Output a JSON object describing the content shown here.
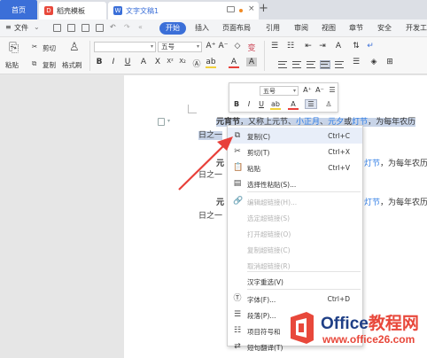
{
  "tabs": {
    "home": "首页",
    "template": "稻壳模板",
    "document": "文字文稿1",
    "add": "+"
  },
  "menubar": {
    "file": "文件",
    "file_icon": "hamburger-icon",
    "quick_arrows": "«",
    "start": "开始",
    "items": [
      "插入",
      "页面布局",
      "引用",
      "审阅",
      "视图",
      "章节",
      "安全",
      "开发工"
    ]
  },
  "ribbon": {
    "paste": "粘贴",
    "cut": "剪切",
    "copy": "复制",
    "format_painter": "格式刷",
    "font_size": "五号",
    "font_name": "",
    "bold": "B",
    "italic": "I",
    "underline": "U",
    "grow_font": "A⁺",
    "shrink_font": "A⁻",
    "clear_format": "◇",
    "phonetic": "变"
  },
  "document": {
    "line1_bold": "元宵节",
    "line1_text_a": "，又称上元节、",
    "line1_link1": "小正月",
    "line1_text_b": "、",
    "line1_link2": "元夕",
    "line1_text_c": "或",
    "line1_link3": "灯节",
    "line1_text_d": "，为每年农历",
    "line2": "日之一",
    "line3_bold": "元",
    "line3_link": "灯节",
    "line3_text": "，为每年农历",
    "line4": "日之一",
    "line5_bold": "元",
    "line5_link": "灯节",
    "line5_text": "，为每年农历",
    "line6": "日之一"
  },
  "mini_toolbar": {
    "font_size": "五号",
    "grow": "A⁺",
    "shrink": "A⁻",
    "bold": "B",
    "italic": "I",
    "underline": "U"
  },
  "context_menu": {
    "items": [
      {
        "label": "复制(C)",
        "shortcut": "Ctrl+C",
        "icon": "copy-icon",
        "glyph": "⧉",
        "enabled": true
      },
      {
        "label": "剪切(T)",
        "shortcut": "Ctrl+X",
        "icon": "scissors-icon",
        "glyph": "✂",
        "enabled": true
      },
      {
        "label": "粘贴",
        "shortcut": "Ctrl+V",
        "icon": "paste-icon",
        "glyph": "📋",
        "enabled": true
      },
      {
        "label": "选择性粘贴(S)...",
        "shortcut": "",
        "icon": "paste-special-icon",
        "glyph": "▤",
        "enabled": true
      },
      {
        "label": "编辑超链接(H)...",
        "shortcut": "",
        "icon": "link-icon",
        "glyph": "🔗",
        "enabled": false
      },
      {
        "label": "选定超链接(S)",
        "shortcut": "",
        "icon": "",
        "glyph": "",
        "enabled": false
      },
      {
        "label": "打开超链接(O)",
        "shortcut": "",
        "icon": "",
        "glyph": "",
        "enabled": false
      },
      {
        "label": "复制超链接(C)",
        "shortcut": "",
        "icon": "",
        "glyph": "",
        "enabled": false
      },
      {
        "label": "取消超链接(R)",
        "shortcut": "",
        "icon": "",
        "glyph": "",
        "enabled": false
      },
      {
        "label": "汉字重选(V)",
        "shortcut": "",
        "icon": "",
        "glyph": "",
        "enabled": true
      },
      {
        "label": "字体(F)...",
        "shortcut": "Ctrl+D",
        "icon": "font-icon",
        "glyph": "Ⓣ",
        "enabled": true
      },
      {
        "label": "段落(P)...",
        "shortcut": "",
        "icon": "paragraph-icon",
        "glyph": "☰",
        "enabled": true
      },
      {
        "label": "项目符号和",
        "shortcut": "",
        "icon": "bullets-icon",
        "glyph": "☷",
        "enabled": true
      },
      {
        "label": "短句翻译(T)",
        "shortcut": "",
        "icon": "translate-icon",
        "glyph": "⇄",
        "enabled": true
      }
    ]
  },
  "watermark": {
    "brand_en": "Office",
    "brand_cn": "教程网",
    "url": "www.office26.com"
  },
  "colors": {
    "accent": "#3b6fd8",
    "link": "#2c7be5",
    "arrow": "#e8403a",
    "selection": "#c8d4e8"
  }
}
